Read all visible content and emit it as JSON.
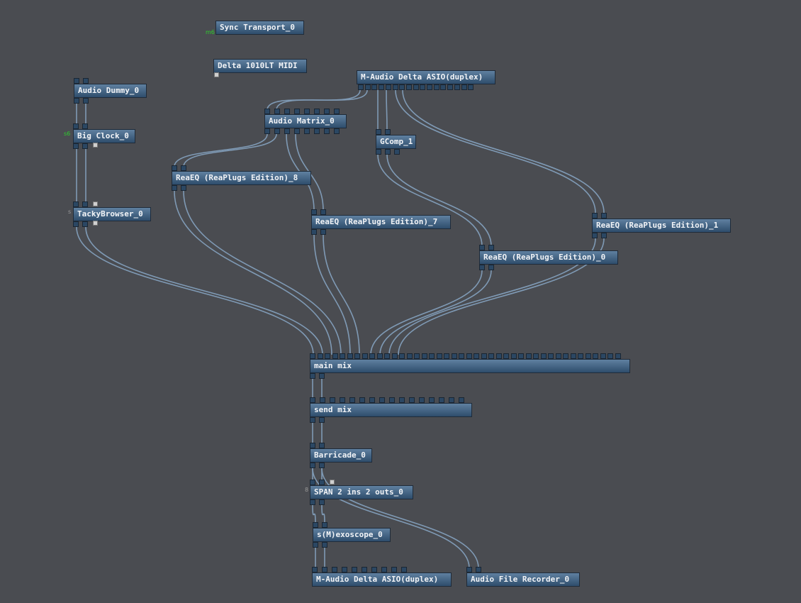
{
  "canvas": {
    "background": "#4a4c51",
    "wire_color": "#7f9ab5",
    "node_color": "#3f5f80"
  },
  "nodes": {
    "sync_transport": {
      "label": "Sync Transport_0",
      "tag": "m6"
    },
    "delta_midi": {
      "label": "Delta 1010LT MIDI"
    },
    "maudio_in": {
      "label": "M-Audio Delta ASIO(duplex)"
    },
    "audio_dummy": {
      "label": "Audio Dummy_0"
    },
    "big_clock": {
      "label": "Big Clock_0",
      "tag": "s6"
    },
    "tacky_browser": {
      "label": "TackyBrowser_0",
      "tag": "s"
    },
    "audio_matrix": {
      "label": "Audio Matrix_0"
    },
    "gcomp": {
      "label": "GComp_1"
    },
    "reaeq_8": {
      "label": "ReaEQ (ReaPlugs Edition)_8"
    },
    "reaeq_7": {
      "label": "ReaEQ (ReaPlugs Edition)_7"
    },
    "reaeq_1": {
      "label": "ReaEQ (ReaPlugs Edition)_1"
    },
    "reaeq_0": {
      "label": "ReaEQ (ReaPlugs Edition)_0"
    },
    "main_mix": {
      "label": "main mix"
    },
    "send_mix": {
      "label": "send mix"
    },
    "barricade": {
      "label": "Barricade_0"
    },
    "span": {
      "label": "SPAN 2 ins 2 outs_0",
      "tag": "8"
    },
    "exoscope": {
      "label": "s(M)exoscope_0"
    },
    "maudio_out": {
      "label": "M-Audio Delta ASIO(duplex)"
    },
    "file_recorder": {
      "label": "Audio File Recorder_0"
    }
  }
}
